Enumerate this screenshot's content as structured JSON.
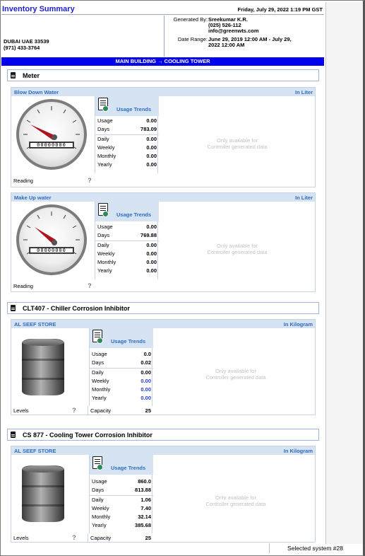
{
  "header": {
    "title": "Inventory Summary",
    "datetime": "Friday, July 29, 2022  1:19 PM GST"
  },
  "address": {
    "line1": "DUBAI UAE  33539",
    "line2": "(971) 433-3764"
  },
  "meta": {
    "generated_by_label": "Generated By:",
    "generated_by_name": "Sreekumar K.R.",
    "generated_by_phone": "(025) 526-112",
    "generated_by_email": "info@greenwts.com",
    "date_range_label": "Date Range:",
    "date_range_line1": "June 29, 2019 12:00 AM - July 29,",
    "date_range_line2": "2022 12:00 AM"
  },
  "location": "MAIN BUILDING → COOLING TOWER",
  "sections": [
    {
      "title": "Meter"
    },
    {
      "title": "CLT407 - Chiller Corrosion Inhibitor"
    },
    {
      "title": "CS 877 - Cooling Tower Corrosion Inhibitor"
    }
  ],
  "usage_trends_label": "Usage Trends",
  "controller_note_line1": "Only available for",
  "controller_note_line2": "Controller generated data",
  "panels": [
    {
      "name": "Blow Down Water",
      "unit": "In Liter",
      "odometer": "00000000",
      "footer_label": "Reading",
      "rows": {
        "usage": {
          "k": "Usage",
          "v": "0.00"
        },
        "days": {
          "k": "Days",
          "v": "783.09"
        },
        "daily": {
          "k": "Daily",
          "v": "0.00"
        },
        "weekly": {
          "k": "Weekly",
          "v": "0.00"
        },
        "monthly": {
          "k": "Monthly",
          "v": "0.00"
        },
        "yearly": {
          "k": "Yearly",
          "v": "0.00"
        }
      }
    },
    {
      "name": "Make Up water",
      "unit": "In Liter",
      "odometer": "00000000",
      "footer_label": "Reading",
      "rows": {
        "usage": {
          "k": "Usage",
          "v": "0.00"
        },
        "days": {
          "k": "Days",
          "v": "769.88"
        },
        "daily": {
          "k": "Daily",
          "v": "0.00"
        },
        "weekly": {
          "k": "Weekly",
          "v": "0.00"
        },
        "monthly": {
          "k": "Monthly",
          "v": "0.00"
        },
        "yearly": {
          "k": "Yearly",
          "v": "0.00"
        }
      }
    },
    {
      "name": "AL SEEF STORE",
      "unit": "In Kilogram",
      "footer_label": "Levels",
      "capacity_label": "Capacity",
      "capacity_value": "25",
      "rows": {
        "usage": {
          "k": "Usage",
          "v": "0.0"
        },
        "days": {
          "k": "Days",
          "v": "0.02"
        },
        "daily": {
          "k": "Daily",
          "v": "0.00"
        },
        "weekly": {
          "k": "Weekly",
          "v": "0.00"
        },
        "monthly": {
          "k": "Monthly",
          "v": "0.00"
        },
        "yearly": {
          "k": "Yearly",
          "v": "0.00"
        }
      }
    },
    {
      "name": "AL SEEF STORE",
      "unit": "In Kilogram",
      "footer_label": "Levels",
      "capacity_label": "Capacity",
      "capacity_value": "25",
      "rows": {
        "usage": {
          "k": "Usage",
          "v": "860.0"
        },
        "days": {
          "k": "Days",
          "v": "813.88"
        },
        "daily": {
          "k": "Daily",
          "v": "1.06"
        },
        "weekly": {
          "k": "Weekly",
          "v": "7.40"
        },
        "monthly": {
          "k": "Monthly",
          "v": "32.14"
        },
        "yearly": {
          "k": "Yearly",
          "v": "385.68"
        }
      }
    }
  ],
  "status_bar": "Selected system #28",
  "colors": {
    "title": "#2222cc",
    "location_bar": "#0000ee",
    "panel_header": "#d6e3f3",
    "panel_header_text": "#2f6cbf",
    "needle": "#b0121e"
  }
}
